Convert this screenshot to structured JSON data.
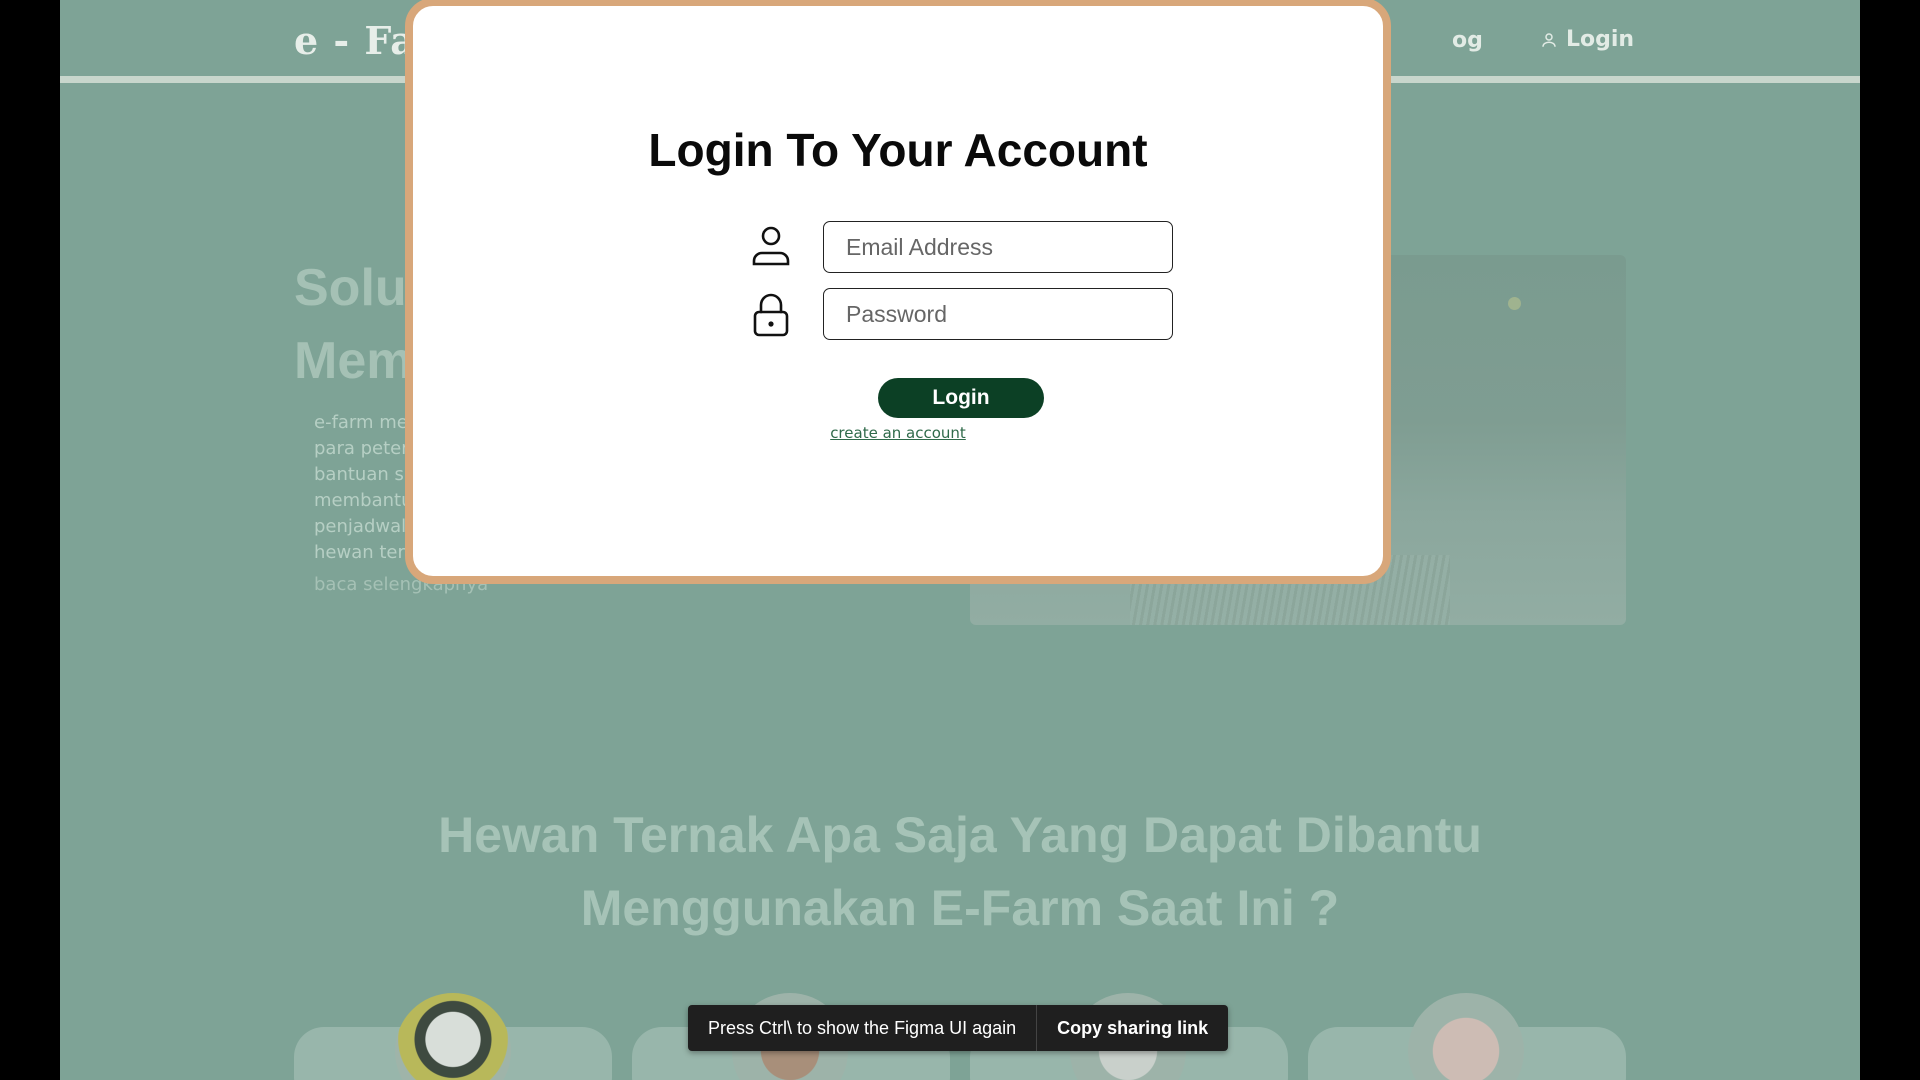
{
  "navbar": {
    "brand": "e - Farm",
    "blog_partial": "og",
    "login_label": "Login"
  },
  "hero": {
    "title_line1": "Solusi I",
    "title_line2": "Memili",
    "desc_lines": [
      "e-farm merupak",
      "para peternak u",
      "bantuan sistem",
      "membantu unt",
      "penjadwalan pe",
      "hewan ternak."
    ],
    "read_more": "baca selengkapnya"
  },
  "section": {
    "title_line1": "Hewan Ternak Apa Saja Yang Dapat Dibantu",
    "title_line2": "Menggunakan E-Farm Saat Ini ?"
  },
  "modal": {
    "title": "Login To Your Account",
    "email_placeholder": "Email Address",
    "password_placeholder": "Password",
    "login_button": "Login",
    "create_account": "create an account"
  },
  "toast": {
    "message": "Press Ctrl\\ to show the Figma UI again",
    "action": "Copy sharing link"
  },
  "colors": {
    "overlay_bg": "#7ea396",
    "modal_border": "#d8a77a",
    "login_button_bg": "#0c4025"
  }
}
